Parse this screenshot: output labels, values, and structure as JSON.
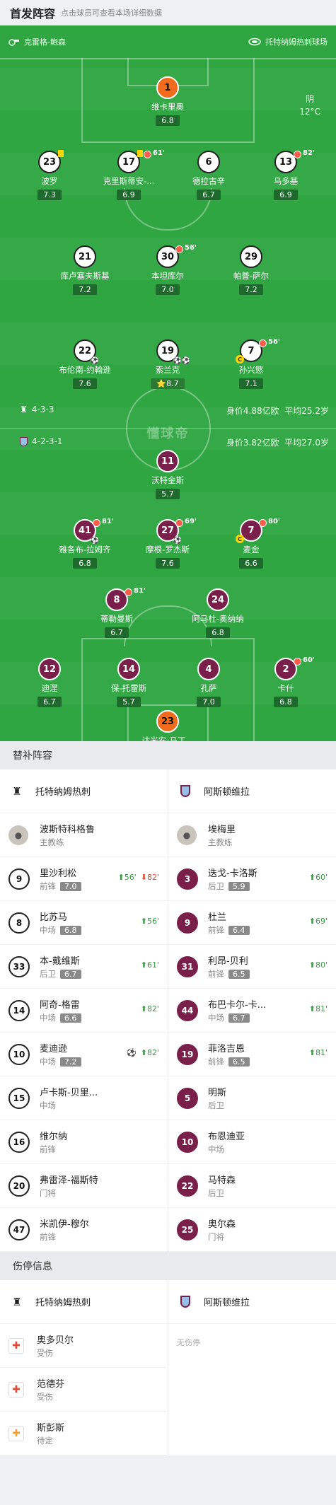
{
  "header": {
    "title": "首发阵容",
    "subtitle": "点击球员可查看本场详细数据"
  },
  "pitch": {
    "referee": "克雷格-鲍森",
    "stadium": "托特纳姆热刺球场",
    "weather": "阴",
    "temperature": "12°C",
    "watermark": "懂球帝",
    "home": {
      "formation": "4-3-3",
      "value": "身价4.88亿欧",
      "avg_age": "平均25.2岁"
    },
    "away": {
      "formation": "4-2-3-1",
      "value": "身价3.82亿欧",
      "avg_age": "平均27.0岁"
    }
  },
  "players": [
    {
      "n": "1",
      "name": "维卡里奥",
      "rating": "6.8",
      "team": "o"
    },
    {
      "n": "23",
      "name": "波罗",
      "rating": "7.3",
      "team": "w",
      "yellow": true
    },
    {
      "n": "17",
      "name": "克里斯蒂安-...",
      "rating": "6.9",
      "team": "w",
      "yellow": true,
      "sub": "61'"
    },
    {
      "n": "6",
      "name": "德拉古辛",
      "rating": "6.7",
      "team": "w"
    },
    {
      "n": "13",
      "name": "乌多基",
      "rating": "6.9",
      "team": "w",
      "sub": "82'"
    },
    {
      "n": "21",
      "name": "库卢塞夫斯基",
      "rating": "7.2",
      "team": "w"
    },
    {
      "n": "30",
      "name": "本坦库尔",
      "rating": "7.0",
      "team": "w",
      "sub": "56'"
    },
    {
      "n": "29",
      "name": "帕普-萨尔",
      "rating": "7.2",
      "team": "w"
    },
    {
      "n": "22",
      "name": "布伦南-约翰逊",
      "rating": "7.6",
      "team": "w",
      "goals": 1
    },
    {
      "n": "19",
      "name": "索兰克",
      "rating": "8.7",
      "team": "w",
      "goals": 2,
      "star": true
    },
    {
      "n": "7",
      "name": "孙兴慜",
      "rating": "7.1",
      "team": "w",
      "sub": "56'",
      "captain": true
    },
    {
      "n": "11",
      "name": "沃特金斯",
      "rating": "5.7",
      "team": "v"
    },
    {
      "n": "41",
      "name": "雅各布-拉姆齐",
      "rating": "6.8",
      "team": "v",
      "sub": "81'",
      "goals": 1
    },
    {
      "n": "27",
      "name": "摩根-罗杰斯",
      "rating": "7.6",
      "team": "v",
      "sub": "69'",
      "goals": 1
    },
    {
      "n": "7",
      "name": "麦金",
      "rating": "6.6",
      "team": "v",
      "sub": "80'",
      "captain": true
    },
    {
      "n": "8",
      "name": "蒂勒曼斯",
      "rating": "6.7",
      "team": "v",
      "sub": "81'"
    },
    {
      "n": "24",
      "name": "阿马杜-奥纳纳",
      "rating": "6.8",
      "team": "v"
    },
    {
      "n": "12",
      "name": "迪涅",
      "rating": "6.7",
      "team": "v"
    },
    {
      "n": "14",
      "name": "保-托雷斯",
      "rating": "5.7",
      "team": "v"
    },
    {
      "n": "4",
      "name": "孔萨",
      "rating": "7.0",
      "team": "v"
    },
    {
      "n": "2",
      "name": "卡什",
      "rating": "6.8",
      "team": "v",
      "sub": "60'"
    },
    {
      "n": "23",
      "name": "达米安-马丁...",
      "rating": "6.3",
      "team": "o"
    }
  ],
  "subs": {
    "title": "替补阵容",
    "home_team": "托特纳姆热刺",
    "away_team": "阿斯顿维拉",
    "home_coach": {
      "name": "波斯特科格鲁",
      "role": "主教练"
    },
    "away_coach": {
      "name": "埃梅里",
      "role": "主教练"
    },
    "home": [
      {
        "n": "9",
        "name": "里沙利松",
        "pos": "前锋",
        "rating": "7.0",
        "in": "56'",
        "out": "82'"
      },
      {
        "n": "8",
        "name": "比苏马",
        "pos": "中场",
        "rating": "6.8",
        "in": "56'"
      },
      {
        "n": "33",
        "name": "本-戴维斯",
        "pos": "后卫",
        "rating": "6.7",
        "in": "61'"
      },
      {
        "n": "14",
        "name": "阿奇-格雷",
        "pos": "中场",
        "rating": "6.6",
        "in": "82'"
      },
      {
        "n": "10",
        "name": "麦迪逊",
        "pos": "中场",
        "rating": "7.2",
        "in": "82'",
        "goal": true
      },
      {
        "n": "15",
        "name": "卢卡斯-贝里...",
        "pos": "中场"
      },
      {
        "n": "16",
        "name": "维尔纳",
        "pos": "前锋"
      },
      {
        "n": "20",
        "name": "弗雷泽-福斯特",
        "pos": "门将"
      },
      {
        "n": "47",
        "name": "米凯伊-穆尔",
        "pos": "前锋"
      }
    ],
    "away": [
      {
        "n": "3",
        "name": "迭戈-卡洛斯",
        "pos": "后卫",
        "rating": "5.9",
        "in": "60'"
      },
      {
        "n": "9",
        "name": "杜兰",
        "pos": "前锋",
        "rating": "6.4",
        "in": "69'"
      },
      {
        "n": "31",
        "name": "利昂-贝利",
        "pos": "前锋",
        "rating": "6.5",
        "in": "80'"
      },
      {
        "n": "44",
        "name": "布巴卡尔-卡...",
        "pos": "中场",
        "rating": "6.7",
        "in": "81'"
      },
      {
        "n": "19",
        "name": "菲洛吉恩",
        "pos": "前锋",
        "rating": "6.5",
        "in": "81'"
      },
      {
        "n": "5",
        "name": "明斯",
        "pos": "后卫"
      },
      {
        "n": "10",
        "name": "布恩迪亚",
        "pos": "中场"
      },
      {
        "n": "22",
        "name": "马特森",
        "pos": "后卫"
      },
      {
        "n": "25",
        "name": "奥尔森",
        "pos": "门将"
      }
    ]
  },
  "injuries": {
    "title": "伤停信息",
    "home_team": "托特纳姆热刺",
    "away_team": "阿斯顿维拉",
    "home": [
      {
        "name": "奥多贝尔",
        "status": "受伤",
        "type": "inj"
      },
      {
        "name": "范德芬",
        "status": "受伤",
        "type": "inj"
      },
      {
        "name": "斯彭斯",
        "status": "待定",
        "type": "doubt"
      }
    ],
    "away_none": "无伤停"
  }
}
